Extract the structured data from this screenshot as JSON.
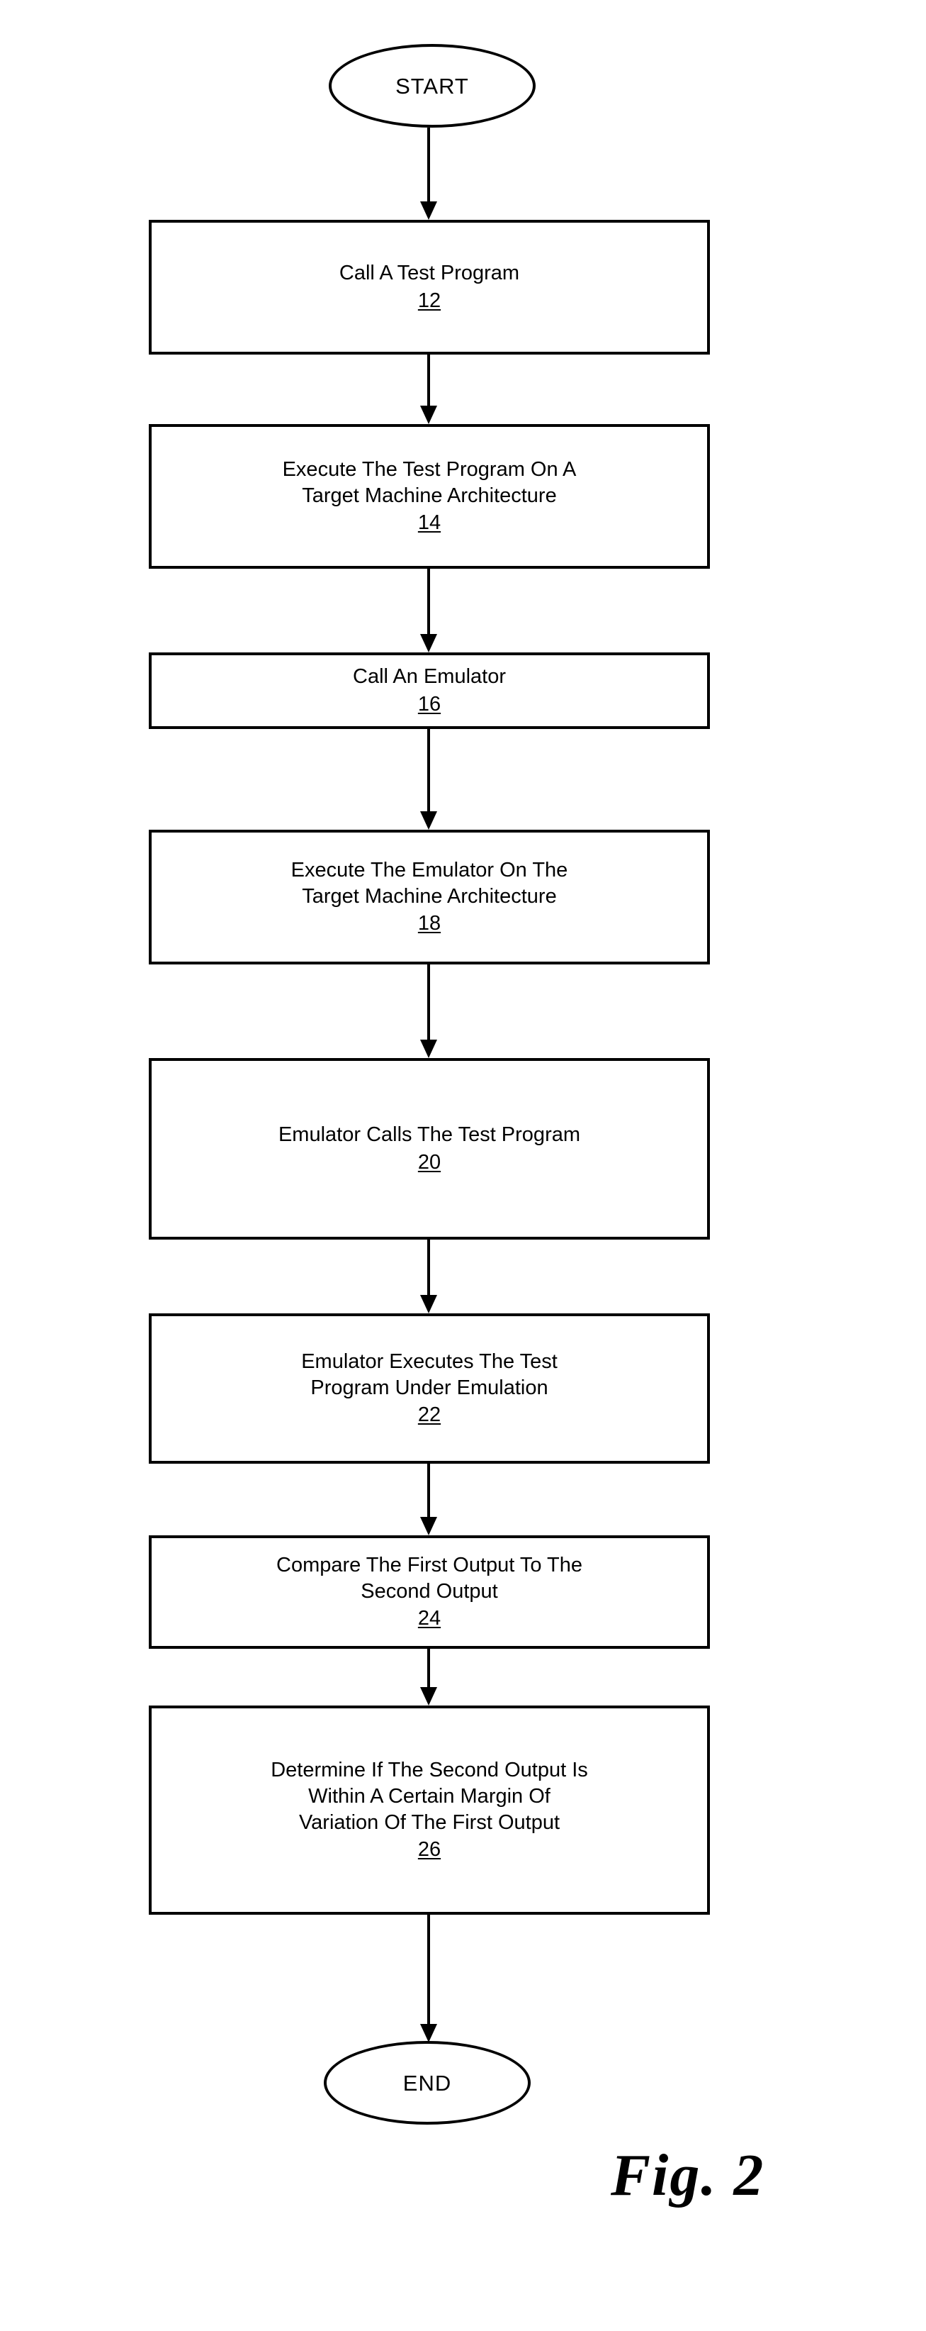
{
  "figure": {
    "caption": "Fig. 2",
    "type": "flowchart"
  },
  "chart_data": {
    "type": "flowchart",
    "title": "Fig. 2",
    "orientation": "top-to-bottom",
    "nodes": [
      {
        "id": "start",
        "shape": "ellipse",
        "label": "START",
        "ref": ""
      },
      {
        "id": "n12",
        "shape": "rectangle",
        "label": "Call A Test Program",
        "ref": "12"
      },
      {
        "id": "n14",
        "shape": "rectangle",
        "label": "Execute The Test Program On A\nTarget Machine Architecture",
        "ref": "14"
      },
      {
        "id": "n16",
        "shape": "rectangle",
        "label": "Call An Emulator",
        "ref": "16"
      },
      {
        "id": "n18",
        "shape": "rectangle",
        "label": "Execute The Emulator On The\nTarget Machine Architecture",
        "ref": "18"
      },
      {
        "id": "n20",
        "shape": "rectangle",
        "label": "Emulator Calls The Test Program",
        "ref": "20"
      },
      {
        "id": "n22",
        "shape": "rectangle",
        "label": "Emulator Executes The Test\nProgram Under Emulation",
        "ref": "22"
      },
      {
        "id": "n24",
        "shape": "rectangle",
        "label": "Compare The First Output To The\nSecond Output",
        "ref": "24"
      },
      {
        "id": "n26",
        "shape": "rectangle",
        "label": "Determine If The Second Output Is\nWithin A Certain Margin Of\nVariation Of The First Output",
        "ref": "26"
      },
      {
        "id": "end",
        "shape": "ellipse",
        "label": "END",
        "ref": ""
      }
    ],
    "edges": [
      {
        "from": "start",
        "to": "n12",
        "style": "arrow"
      },
      {
        "from": "n12",
        "to": "n14",
        "style": "arrow"
      },
      {
        "from": "n14",
        "to": "n16",
        "style": "arrow"
      },
      {
        "from": "n16",
        "to": "n18",
        "style": "arrow"
      },
      {
        "from": "n18",
        "to": "n20",
        "style": "arrow"
      },
      {
        "from": "n20",
        "to": "n22",
        "style": "arrow"
      },
      {
        "from": "n22",
        "to": "n24",
        "style": "arrow"
      },
      {
        "from": "n24",
        "to": "n26",
        "style": "arrow"
      },
      {
        "from": "n26",
        "to": "end",
        "style": "arrow"
      }
    ],
    "colors": {
      "stroke": "#000000",
      "fill": "#ffffff",
      "text": "#000000"
    }
  },
  "terminators": {
    "start": {
      "label": "START"
    },
    "end": {
      "label": "END"
    }
  },
  "steps": [
    {
      "label": "Call A Test Program",
      "ref": "12"
    },
    {
      "label": "Execute The Test Program On A\nTarget Machine Architecture",
      "ref": "14"
    },
    {
      "label": "Call An Emulator",
      "ref": "16"
    },
    {
      "label": "Execute The Emulator On The\nTarget Machine Architecture",
      "ref": "18"
    },
    {
      "label": "Emulator Calls The Test Program",
      "ref": "20"
    },
    {
      "label": "Emulator Executes The Test\nProgram Under Emulation",
      "ref": "22"
    },
    {
      "label": "Compare The First Output To The\nSecond Output",
      "ref": "24"
    },
    {
      "label": "Determine If The Second Output Is\nWithin A Certain Margin Of\nVariation Of The First Output",
      "ref": "26"
    }
  ]
}
